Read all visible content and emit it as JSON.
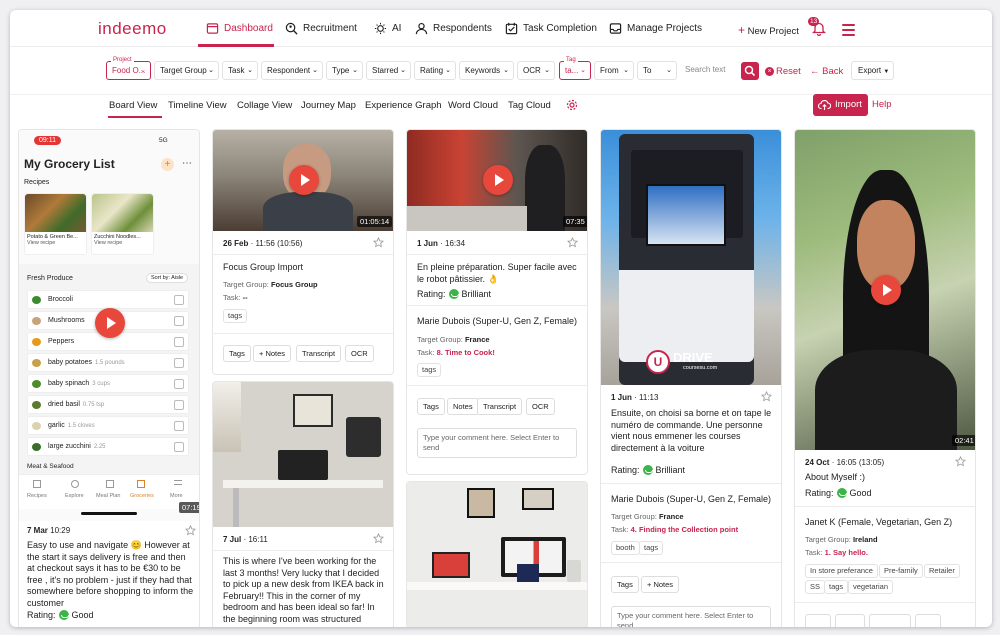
{
  "brand": {
    "logo": "indeemo",
    "accent": "#c8244d"
  },
  "nav": {
    "items": [
      "Dashboard",
      "Recruitment",
      "AI",
      "Respondents",
      "Task Completion",
      "Manage Projects"
    ],
    "new_project": "New Project",
    "notif_count": "13"
  },
  "filters": {
    "project_label": "Project",
    "project_value": "Food O...",
    "items": [
      "Target Group",
      "Task",
      "Respondent",
      "Type",
      "Starred",
      "Rating",
      "Keywords",
      "OCR"
    ],
    "tag_label": "Tag",
    "tag_value": "ta...",
    "from": "From",
    "to": "To",
    "search_placeholder": "Search text",
    "reset": "Reset",
    "back": "Back",
    "export": "Export"
  },
  "views": {
    "tabs": [
      "Board View",
      "Timeline View",
      "Collage View",
      "Journey Map",
      "Experience Graph",
      "Word Cloud",
      "Tag Cloud"
    ],
    "active": "Board View",
    "import": "Import",
    "help": "Help"
  },
  "phone": {
    "time": "09:11",
    "signal": "5G",
    "title": "My Grocery List",
    "recipes_label": "Recipes",
    "recipe1": "Potato & Green Be...",
    "recipe1_sub": "View recipe",
    "recipe2": "Zucchini Noodles...",
    "recipe2_sub": "View recipe",
    "section": "Fresh Produce",
    "sort": "Sort by: Aisle",
    "items": [
      {
        "name": "Broccoli",
        "qty": "",
        "color": "#3e8b2e"
      },
      {
        "name": "Mushrooms",
        "qty": "",
        "color": "#c9a27a"
      },
      {
        "name": "Peppers",
        "qty": "",
        "color": "#e69a1a"
      },
      {
        "name": "baby potatoes",
        "qty": "1.5 pounds",
        "color": "#c9a04a"
      },
      {
        "name": "baby spinach",
        "qty": "3 cups",
        "color": "#4c8c2a"
      },
      {
        "name": "dried basil",
        "qty": "0.75 tsp",
        "color": "#5b7a2a"
      },
      {
        "name": "garlic",
        "qty": "1.5 cloves",
        "color": "#ddd2b0"
      },
      {
        "name": "large zucchini",
        "qty": "2.25",
        "color": "#3b6e2a"
      }
    ],
    "section2": "Meat & Seafood",
    "tabs": [
      "Recipes",
      "Explore",
      "Meal Plan",
      "Groceries",
      "More"
    ],
    "duration": "07:19"
  },
  "cards": {
    "c1": {
      "date": "7 Mar",
      "time": "10:29",
      "text": "Easy to use and navigate 😊 However at the start it says delivery is free and then at checkout says it has to be €30 to be free , it's no problem - just if they had that somewhere before shopping to inform the customer",
      "rating": "Good"
    },
    "c2": {
      "duration": "01:05:14",
      "date": "26 Feb",
      "time": "11:56",
      "length": "(10:56)",
      "title": "Focus Group Import",
      "tg_label": "Target Group:",
      "tg": "Focus Group",
      "task_label": "Task:",
      "task": "--",
      "tag": "tags",
      "buttons": [
        "Tags",
        "Notes",
        "Transcript",
        "OCR"
      ]
    },
    "c3": {
      "date": "7 Jul",
      "time": "16:11",
      "text": "This is where I've been working for the last 3 months! Very lucky that I decided to pick up a new desk from IKEA back in February!! This in the corner of my bedroom and has been ideal so far! In the beginning room was structured"
    },
    "c4": {
      "duration": "07:35",
      "date": "1 Jun",
      "time": "16:34",
      "text": "En pleine préparation. Super facile avec le robot pâtissier. 👌",
      "rating_label": "Rating:",
      "rating": "Brilliant",
      "person": "Marie Dubois (Super-U, Gen Z, Female)",
      "tg_label": "Target Group:",
      "tg": "France",
      "task_label": "Task:",
      "task": "8. Time to Cook!",
      "tag": "tags",
      "buttons": [
        "Tags",
        "Notes",
        "Transcript",
        "OCR"
      ],
      "comment": "Type your comment here. Select Enter to send"
    },
    "c5": {
      "logo": "DRIVE",
      "logo_sub": "coursesu.com",
      "date": "1 Jun",
      "time": "11:13",
      "text": "Ensuite, on choisi sa borne et on tape le numéro de commande. Une personne vient nous emmener les courses directement à la voiture",
      "rating_label": "Rating:",
      "rating": "Brilliant",
      "person": "Marie Dubois (Super-U, Gen Z, Female)",
      "tg_label": "Target Group:",
      "tg": "France",
      "task_label": "Task:",
      "task": "4. Finding the Collection point",
      "tags": [
        "booth",
        "tags"
      ],
      "buttons": [
        "Tags",
        "Notes"
      ],
      "comment": "Type your comment here. Select Enter to send"
    },
    "c6": {
      "duration": "02:41",
      "date": "24 Oct",
      "time": "16:05",
      "length": "(13:05)",
      "text": "About Myself :)",
      "rating_label": "Rating:",
      "rating": "Good",
      "person": "Janet K (Female, Vegetarian, Gen Z)",
      "tg_label": "Target Group:",
      "tg": "Ireland",
      "task_label": "Task:",
      "task": "1. Say hello.",
      "tags": [
        "In store preferance",
        "Pre-family",
        "Retailer",
        "SS",
        "tags",
        "vegetarian"
      ]
    }
  }
}
